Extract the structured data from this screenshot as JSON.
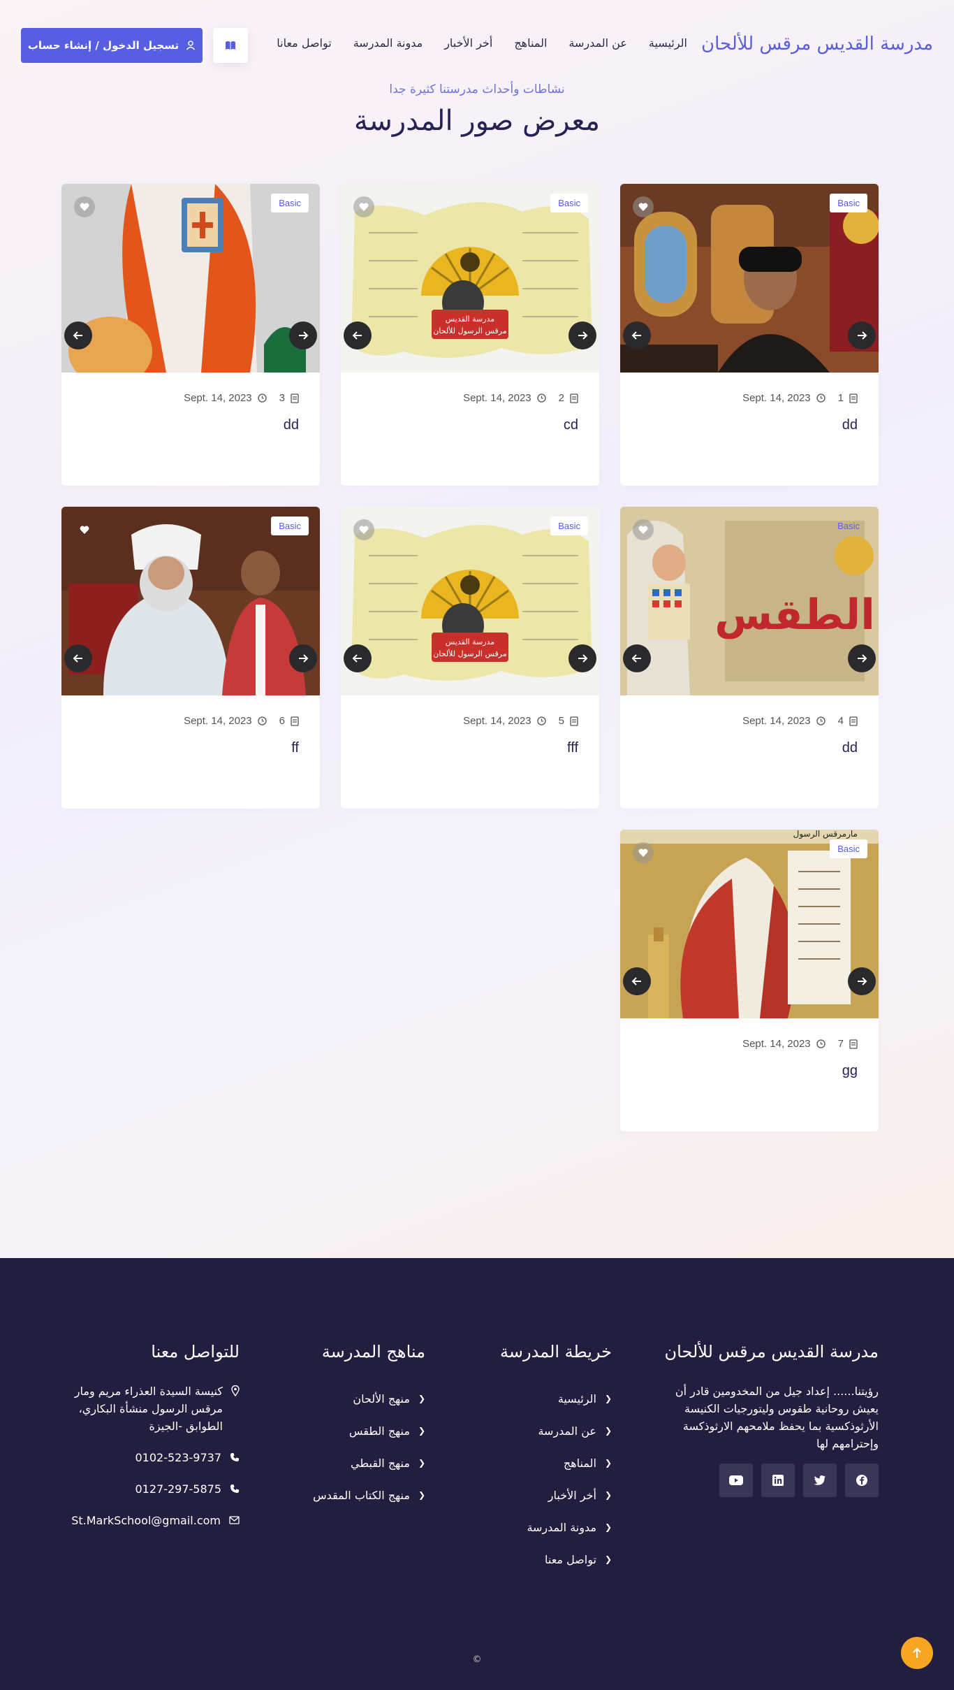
{
  "header": {
    "brand": "مدرسة القديس مرقس للألحان",
    "nav": [
      "الرئيسية",
      "عن المدرسة",
      "المناهج",
      "أخر الأخبار",
      "مدونة المدرسة",
      "تواصل معانا"
    ],
    "login_label": "تسجيل الدخول / إنشاء حساب"
  },
  "hero": {
    "subtitle": "نشاطات وأحداث مدرستنا كثيرة جدا",
    "title": "معرض صور المدرسة"
  },
  "gallery": {
    "badge": "Basic",
    "cards": [
      {
        "num": "1",
        "date": "Sept. 14, 2023",
        "title": "dd"
      },
      {
        "num": "2",
        "date": "Sept. 14, 2023",
        "title": "cd"
      },
      {
        "num": "3",
        "date": "Sept. 14, 2023",
        "title": "dd"
      },
      {
        "num": "4",
        "date": "Sept. 14, 2023",
        "title": "dd"
      },
      {
        "num": "5",
        "date": "Sept. 14, 2023",
        "title": "fff"
      },
      {
        "num": "6",
        "date": "Sept. 14, 2023",
        "title": "ff"
      },
      {
        "num": "7",
        "date": "Sept. 14, 2023",
        "title": "gg"
      }
    ],
    "logo_text_line1": "مدرسة القديس",
    "logo_text_line2": "مرقس الرسول للألحان",
    "image_caption": "الطقس",
    "image_caption_top": "مارمرقس الرسول"
  },
  "footer": {
    "about_title": "مدرسة القديس مرقس للألحان",
    "about_text": "رؤيتنا...... إعداد جيل من المخدومين قادر أن يعيش روحانية طقوس وليتورجيات الكنيسة الأرثوذكسية بما يحفظ ملامحهم الارثوذكسة وإحترامهم لها",
    "map_title": "خريطة المدرسة",
    "map_links": [
      "الرئيسية",
      "عن المدرسة",
      "المناهج",
      "أخر الأخبار",
      "مدونة المدرسة",
      "تواصل معنا"
    ],
    "curricula_title": "مناهج المدرسة",
    "curricula_links": [
      "منهج الألحان",
      "منهج الطقس",
      "منهج القبطي",
      "منهج الكتاب المقدس"
    ],
    "contact_title": "للتواصل معنا",
    "address": "كنيسة السيدة العذراء مريم ومار مرقس الرسول منشأة البكاري، الطوابق -الجيزة",
    "phone1": "0102-523-9737",
    "phone2": "0127-297-5875",
    "email": "St.MarkSchool@gmail.com",
    "copyright": "©"
  },
  "colors": {
    "accent": "#585ee4",
    "footer_bg": "#221e3f",
    "top_button": "#f6a623"
  }
}
